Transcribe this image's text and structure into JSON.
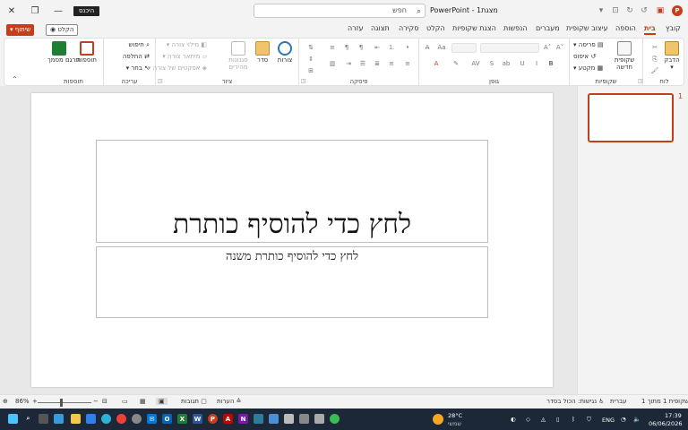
{
  "window": {
    "app_title": "PowerPoint - מצגת1",
    "sign_in": "היכנס",
    "search_placeholder": "חפש",
    "minimize": "—",
    "restore": "❐",
    "close": "✕"
  },
  "tabs": {
    "file": "קובץ",
    "home": "בית",
    "insert": "הוספה",
    "design": "עיצוב שקופית",
    "transitions": "מעברים",
    "animations": "הנפשות",
    "slideshow": "הצגת שקופיות",
    "record": "הקלט",
    "review": "סקירה",
    "view": "תצוגה",
    "help": "עזרה",
    "record_btn": "◉ הקלט",
    "share_btn": "▾ שיתוף"
  },
  "ribbon": {
    "clipboard": {
      "label": "לוח",
      "paste": "הדבק"
    },
    "slides": {
      "label": "שקופיות",
      "new_slide": "שקופית חדשה",
      "layout": "פריסה",
      "reset": "איפוס",
      "section": "מקטע"
    },
    "font": {
      "label": "גופן"
    },
    "paragraph": {
      "label": "פיסקה"
    },
    "drawing": {
      "label": "ציור",
      "shapes": "צורות",
      "arrange": "סדר",
      "quick_styles": "סגנונות מהירים",
      "fill": "מילוי צורה",
      "outline": "מיתאר צורה",
      "effects": "אפקטים של צורה"
    },
    "editing": {
      "label": "עריכה",
      "find": "חיפוש",
      "replace": "החלפה",
      "select": "בחר"
    },
    "addins": {
      "label": "תוספות",
      "addins": "תוספות",
      "translate": "תרגם מסמך"
    }
  },
  "slide": {
    "title_placeholder": "לחץ כדי להוסיף כותרת",
    "subtitle_placeholder": "לחץ כדי להוסיף כותרת משנה"
  },
  "thumbnails": {
    "number": "1"
  },
  "statusbar": {
    "slide_info": "שקופית 1 מתוך 1",
    "language": "עברית",
    "accessibility": "נגישות: הכול בסדר",
    "notes": "הערות",
    "comments": "תגובות",
    "zoom": "86%",
    "zoom_fraction": 0.43
  },
  "taskbar": {
    "temperature": "28°C",
    "weather": "שמשי",
    "language": "ENG",
    "time": "17:39",
    "date": "06/06/2026"
  },
  "colors": {
    "accent": "#c43e1c",
    "taskbar": "#1c2838"
  }
}
